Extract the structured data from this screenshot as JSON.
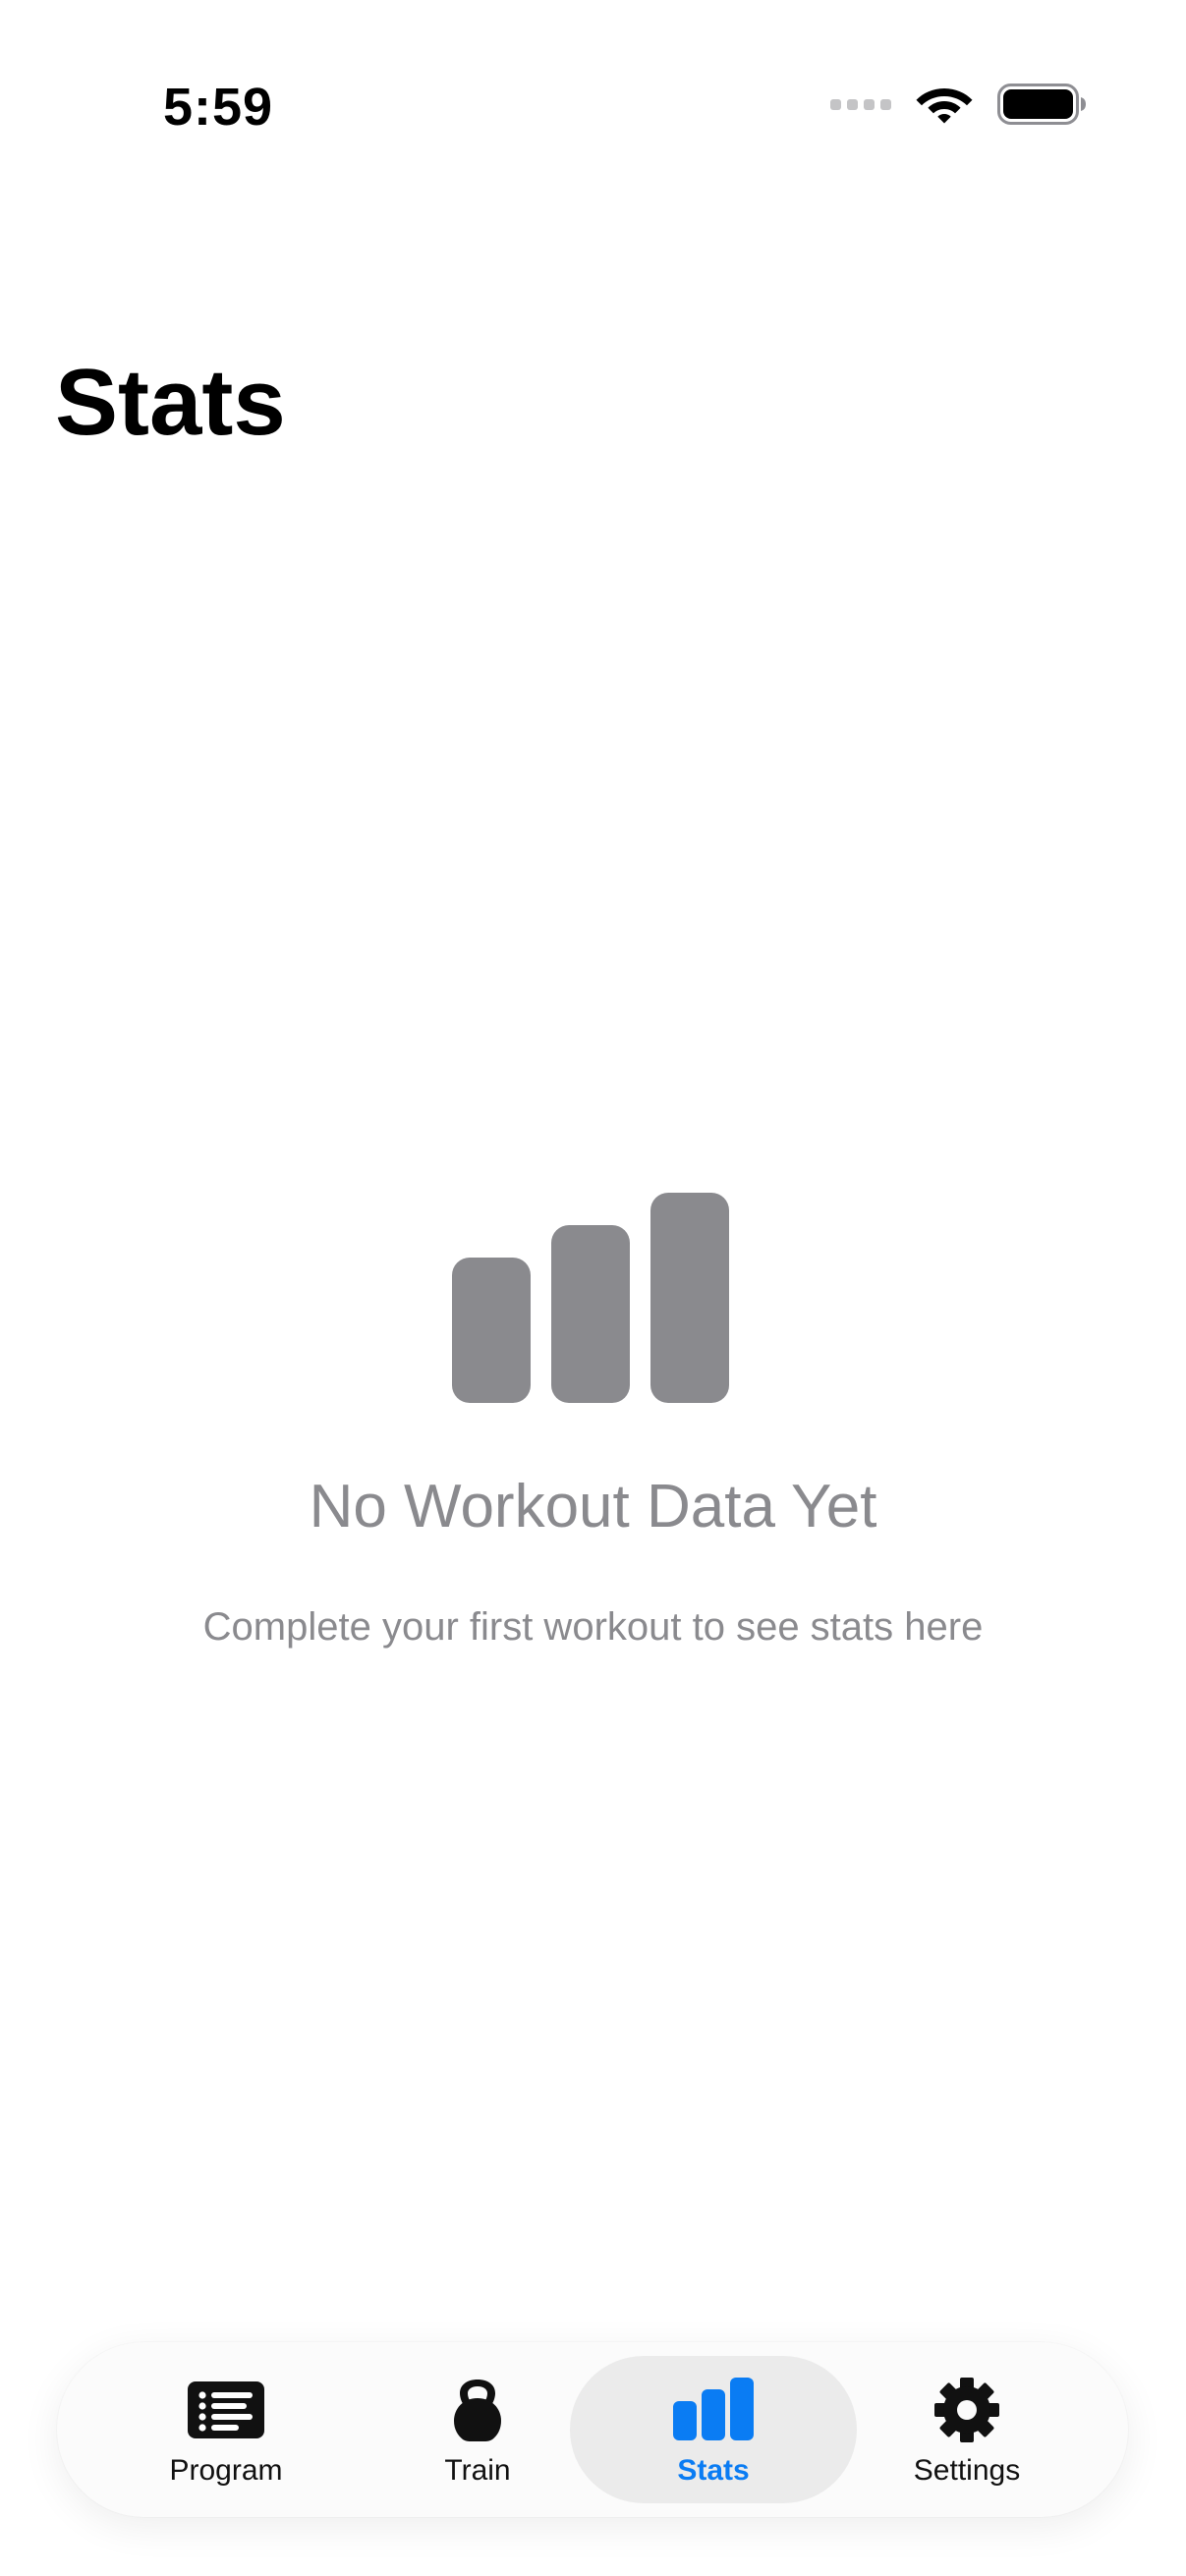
{
  "status_bar": {
    "time": "5:59",
    "icons": [
      "cellular-signal-icon",
      "wifi-icon",
      "battery-icon"
    ]
  },
  "header": {
    "title": "Stats"
  },
  "empty_state": {
    "icon": "bar-chart-icon",
    "title": "No Workout Data Yet",
    "subtitle": "Complete your first workout to see stats here"
  },
  "tab_bar": {
    "items": [
      {
        "label": "Program",
        "icon": "list-icon",
        "active": false
      },
      {
        "label": "Train",
        "icon": "kettlebell-icon",
        "active": false
      },
      {
        "label": "Stats",
        "icon": "bar-chart-icon",
        "active": true
      },
      {
        "label": "Settings",
        "icon": "gear-icon",
        "active": false
      }
    ]
  },
  "colors": {
    "accent": "#0a7cf3",
    "secondary_text": "#8a8a8e",
    "empty_icon": "#8a8a8e",
    "tab_active_bg": "#ebebeb"
  }
}
